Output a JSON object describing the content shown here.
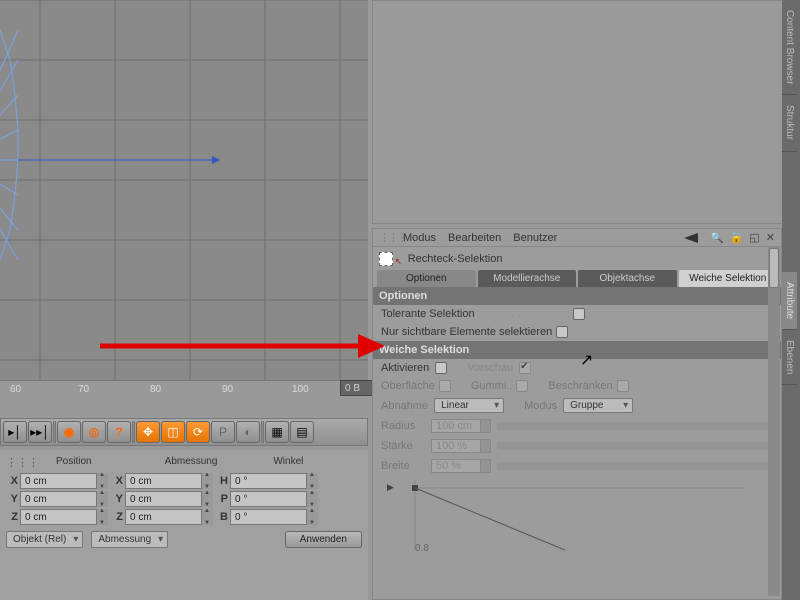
{
  "ruler": {
    "t60": "60",
    "t70": "70",
    "t80": "80",
    "t90": "90",
    "t100": "100"
  },
  "frame_info": "0 B",
  "coords": {
    "head": {
      "position": "Position",
      "size": "Abmessung",
      "angle": "Winkel"
    },
    "axes": {
      "x": "X",
      "y": "Y",
      "z": "Z",
      "h": "H",
      "p": "P",
      "b": "B"
    },
    "zero_cm": "0 cm",
    "zero_deg": "0 °",
    "object_mode": "Objekt (Rel)",
    "size_mode": "Abmessung",
    "apply": "Anwenden"
  },
  "menu": {
    "mode": "Modus",
    "edit": "Bearbeiten",
    "user": "Benutzer"
  },
  "tool_title": "Rechteck-Selektion",
  "tabs": {
    "options": "Optionen",
    "model_axis": "Modellierachse",
    "object_axis": "Objektachse",
    "soft_sel": "Weiche Selektion"
  },
  "sections": {
    "options": "Optionen",
    "soft_sel": "Weiche Selektion"
  },
  "opts": {
    "tolerant": "Tolerante Selektion",
    "visible_only": "Nur sichtbare Elemente selektieren",
    "activate": "Aktivieren",
    "preview": "Vorschau",
    "surface": "Oberfläche",
    "rubber": "Gummi..",
    "restrict": "Beschränken",
    "falloff": "Abnahme",
    "falloff_val": "Linear",
    "mode": "Modus",
    "mode_val": "Gruppe",
    "radius": "Radius",
    "radius_val": "100 cm",
    "strength": "Stärke",
    "strength_val": "100 %",
    "width": "Breite",
    "width_val": "50 %"
  },
  "curve": {
    "ytick": "0.8"
  },
  "side_tabs": {
    "content": "Content Browser",
    "struct": "Struktur",
    "attr": "Attribute",
    "layers": "Ebenen"
  }
}
